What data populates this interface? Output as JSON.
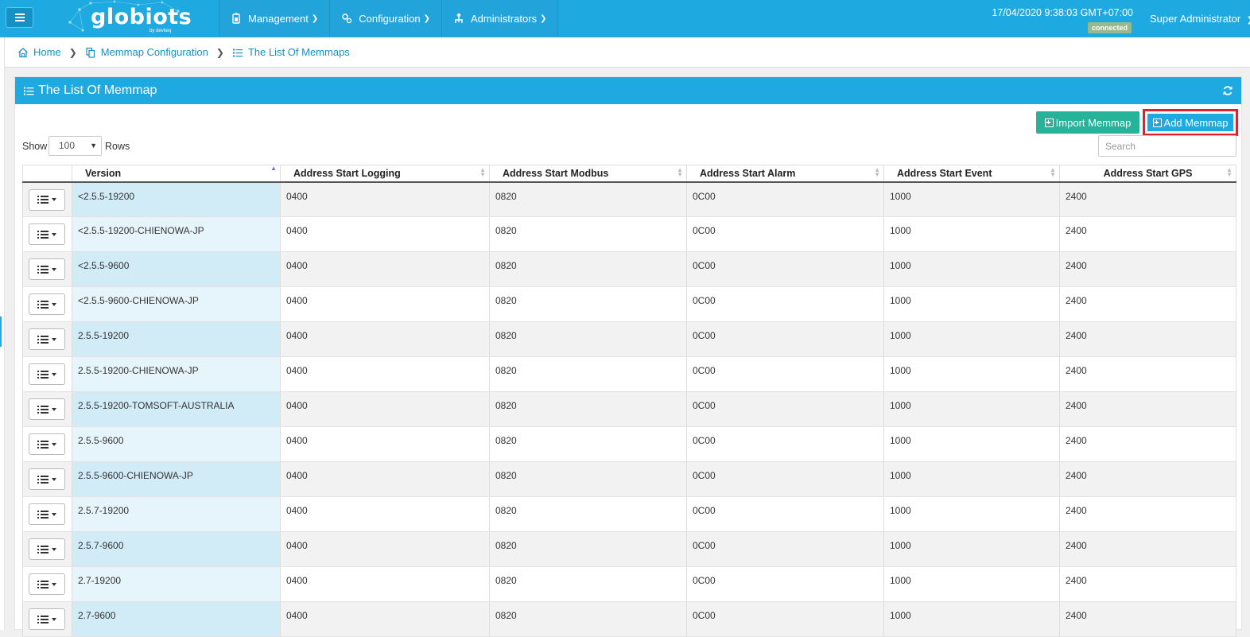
{
  "header": {
    "logo_text": "globiots",
    "logo_sub": "by deviteq",
    "nav": [
      {
        "label": "Management",
        "icon": "battery-icon"
      },
      {
        "label": "Configuration",
        "icon": "gears-icon"
      },
      {
        "label": "Administrators",
        "icon": "sitemap-icon"
      }
    ],
    "datetime": "17/04/2020 9:38:03 GMT+07:00",
    "connection_status": "connected",
    "user": "Super Administrator"
  },
  "breadcrumb": [
    {
      "label": "Home",
      "icon": "home-icon"
    },
    {
      "label": "Memmap Configuration",
      "icon": "copy-icon"
    },
    {
      "label": "The List Of Memmaps",
      "icon": "list-icon"
    }
  ],
  "panel": {
    "title": "The List Of Memmap",
    "import_label": "Import Memmap",
    "add_label": "Add Memmap",
    "show_label": "Show",
    "rows_value": "100",
    "rows_label": "Rows",
    "search_placeholder": "Search"
  },
  "table": {
    "columns": [
      "Version",
      "Address Start Logging",
      "Address Start Modbus",
      "Address Start Alarm",
      "Address Start Event",
      "Address Start GPS"
    ],
    "rows": [
      [
        "<2.5.5-19200",
        "0400",
        "0820",
        "0C00",
        "1000",
        "2400"
      ],
      [
        "<2.5.5-19200-CHIENOWA-JP",
        "0400",
        "0820",
        "0C00",
        "1000",
        "2400"
      ],
      [
        "<2.5.5-9600",
        "0400",
        "0820",
        "0C00",
        "1000",
        "2400"
      ],
      [
        "<2.5.5-9600-CHIENOWA-JP",
        "0400",
        "0820",
        "0C00",
        "1000",
        "2400"
      ],
      [
        "2.5.5-19200",
        "0400",
        "0820",
        "0C00",
        "1000",
        "2400"
      ],
      [
        "2.5.5-19200-CHIENOWA-JP",
        "0400",
        "0820",
        "0C00",
        "1000",
        "2400"
      ],
      [
        "2.5.5-19200-TOMSOFT-AUSTRALIA",
        "0400",
        "0820",
        "0C00",
        "1000",
        "2400"
      ],
      [
        "2.5.5-9600",
        "0400",
        "0820",
        "0C00",
        "1000",
        "2400"
      ],
      [
        "2.5.5-9600-CHIENOWA-JP",
        "0400",
        "0820",
        "0C00",
        "1000",
        "2400"
      ],
      [
        "2.5.7-19200",
        "0400",
        "0820",
        "0C00",
        "1000",
        "2400"
      ],
      [
        "2.5.7-9600",
        "0400",
        "0820",
        "0C00",
        "1000",
        "2400"
      ],
      [
        "2.7-19200",
        "0400",
        "0820",
        "0C00",
        "1000",
        "2400"
      ],
      [
        "2.7-9600",
        "0400",
        "0820",
        "0C00",
        "1000",
        "2400"
      ]
    ]
  },
  "colors": {
    "primary": "#1eaae0",
    "import_button": "#26b39a",
    "highlight_border": "#e0202d",
    "connected_badge": "#97b98b"
  }
}
